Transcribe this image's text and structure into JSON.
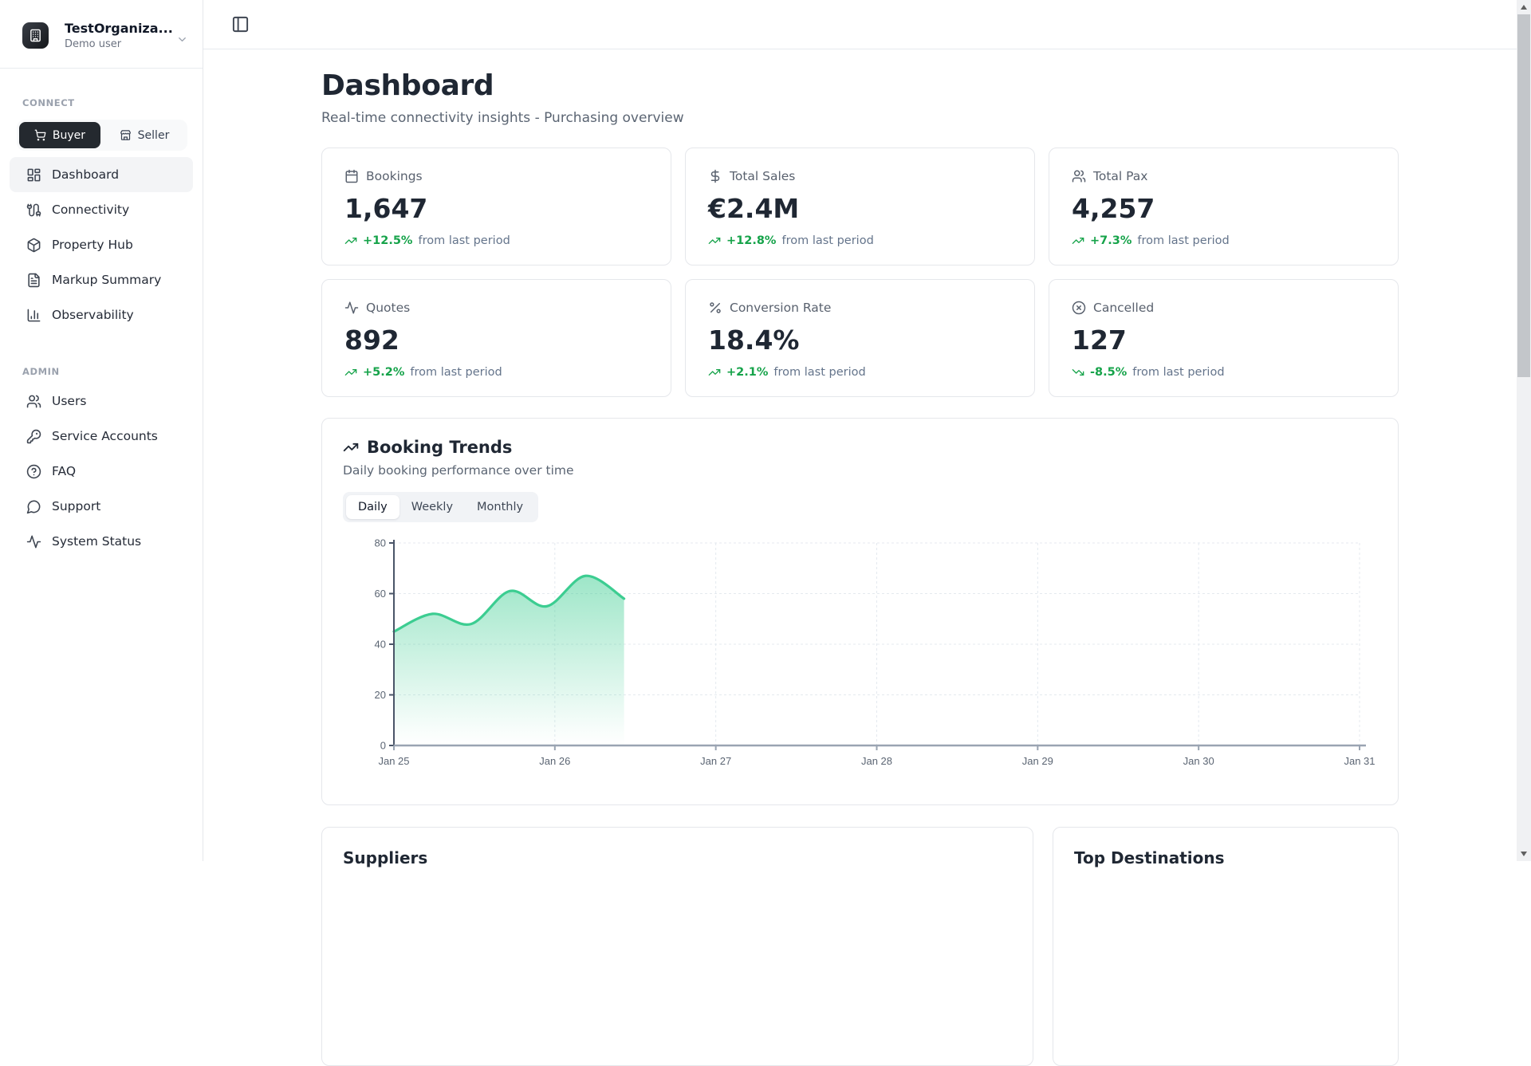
{
  "org": {
    "name": "TestOrganiza...",
    "subtitle": "Demo user"
  },
  "sidebar": {
    "connect_label": "CONNECT",
    "admin_label": "ADMIN",
    "roles": {
      "buyer": "Buyer",
      "seller": "Seller",
      "active": "Buyer"
    },
    "connect_items": [
      {
        "label": "Dashboard",
        "icon": "layout-dashboard-icon",
        "active": true
      },
      {
        "label": "Connectivity",
        "icon": "cable-icon",
        "active": false
      },
      {
        "label": "Property Hub",
        "icon": "package-icon",
        "active": false
      },
      {
        "label": "Markup Summary",
        "icon": "file-text-icon",
        "active": false
      },
      {
        "label": "Observability",
        "icon": "chart-column-icon",
        "active": false
      }
    ],
    "admin_items": [
      {
        "label": "Users",
        "icon": "users-icon"
      },
      {
        "label": "Service Accounts",
        "icon": "key-icon"
      },
      {
        "label": "FAQ",
        "icon": "help-circle-icon"
      },
      {
        "label": "Support",
        "icon": "message-circle-icon"
      },
      {
        "label": "System Status",
        "icon": "activity-icon"
      }
    ]
  },
  "page": {
    "title": "Dashboard",
    "subtitle": "Real-time connectivity insights - Purchasing overview"
  },
  "stats": [
    {
      "label": "Bookings",
      "value": "1,647",
      "trend": "+12.5%",
      "suffix": "from last period",
      "direction": "up",
      "icon": "calendar-icon"
    },
    {
      "label": "Total Sales",
      "value": "€2.4M",
      "trend": "+12.8%",
      "suffix": "from last period",
      "direction": "up",
      "icon": "dollar-icon"
    },
    {
      "label": "Total Pax",
      "value": "4,257",
      "trend": "+7.3%",
      "suffix": "from last period",
      "direction": "up",
      "icon": "users-icon"
    },
    {
      "label": "Quotes",
      "value": "892",
      "trend": "+5.2%",
      "suffix": "from last period",
      "direction": "up",
      "icon": "activity-icon"
    },
    {
      "label": "Conversion Rate",
      "value": "18.4%",
      "trend": "+2.1%",
      "suffix": "from last period",
      "direction": "up",
      "icon": "percent-icon"
    },
    {
      "label": "Cancelled",
      "value": "127",
      "trend": "-8.5%",
      "suffix": "from last period",
      "direction": "down",
      "icon": "circle-x-icon"
    }
  ],
  "trends_card": {
    "title": "Booking Trends",
    "subtitle": "Daily booking performance over time",
    "tabs": [
      {
        "label": "Daily",
        "active": true
      },
      {
        "label": "Weekly",
        "active": false
      },
      {
        "label": "Monthly",
        "active": false
      }
    ]
  },
  "chart_data": {
    "type": "area",
    "title": "Booking Trends",
    "series_name": "Bookings",
    "x_unit": "days since Jan 25",
    "x": [
      0,
      0.24,
      0.48,
      0.72,
      0.95,
      1.19,
      1.43
    ],
    "values": [
      45,
      52,
      48,
      61,
      55,
      67,
      58
    ],
    "xlim": [
      0,
      6
    ],
    "ylim": [
      0,
      80
    ],
    "x_tick_positions": [
      0,
      1,
      2,
      3,
      4,
      5,
      6
    ],
    "x_tick_labels": [
      "Jan 25",
      "Jan 26",
      "Jan 27",
      "Jan 28",
      "Jan 29",
      "Jan 30",
      "Jan 31"
    ],
    "y_ticks": [
      0,
      20,
      40,
      60,
      80
    ],
    "grid": true,
    "legend": false,
    "line_color": "#3ccd91",
    "fill": "vertical gradient rgba(60,205,145,0.5) to transparent"
  },
  "bottom_cards": {
    "suppliers_title": "Suppliers",
    "destinations_title": "Top Destinations"
  },
  "colors": {
    "accent_green": "#16a34a",
    "chart_green": "#3ccd91",
    "text_dark": "#1f2733",
    "text_muted": "#64748b",
    "border": "#e5e7eb",
    "active_item_bg": "#f3f4f6",
    "buyer_button_bg": "#24292f"
  }
}
